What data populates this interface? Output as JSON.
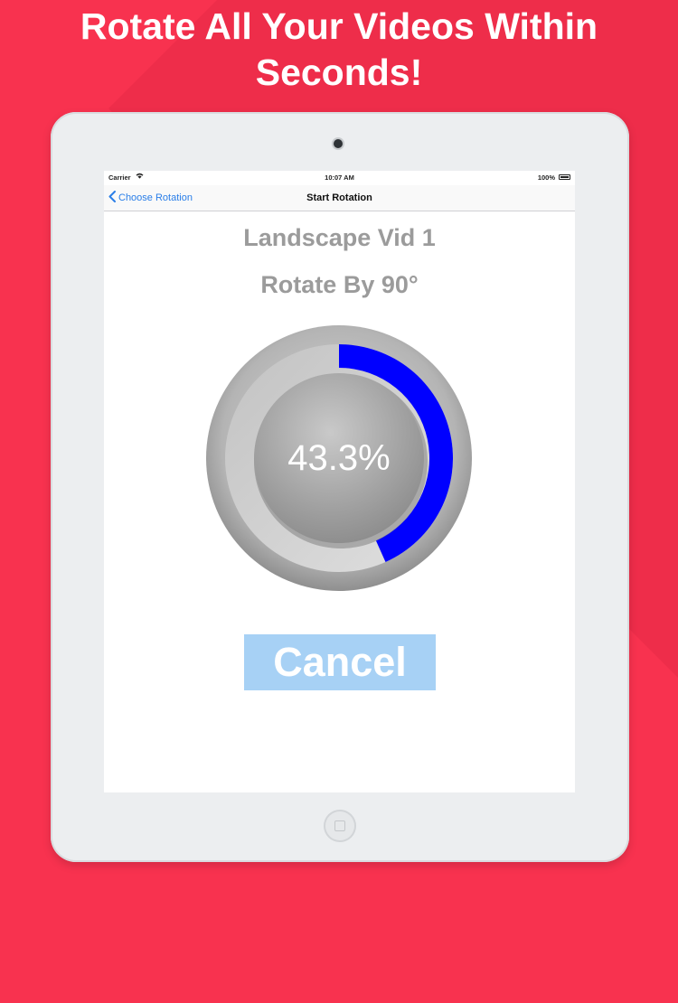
{
  "headline": {
    "line1": "Rotate All Your Videos Within",
    "line2": "Seconds!"
  },
  "status_bar": {
    "carrier": "Carrier",
    "time": "10:07 AM",
    "battery": "100%"
  },
  "nav": {
    "back_label": "Choose Rotation",
    "title": "Start Rotation"
  },
  "content": {
    "video_name": "Landscape Vid 1",
    "rotation": "Rotate By 90°",
    "progress_label": "43.3%",
    "progress_value": 0.433,
    "cancel_label": "Cancel"
  },
  "colors": {
    "background": "#f8324f",
    "progress_arc": "#0000ff",
    "cancel_button": "#a7d1f5",
    "nav_link": "#2a7ee8"
  },
  "icons": [
    "chevron-left-icon",
    "wifi-icon",
    "battery-icon",
    "camera-icon",
    "home-button-icon"
  ]
}
